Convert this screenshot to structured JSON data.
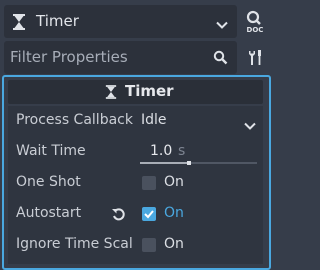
{
  "node_selector": {
    "name": "Timer",
    "icon": "hourglass-icon"
  },
  "doc_button": {
    "label": "DOC"
  },
  "filter": {
    "placeholder": "Filter Properties"
  },
  "section": {
    "title": "Timer"
  },
  "properties": {
    "process_callback": {
      "label": "Process Callback",
      "value": "Idle"
    },
    "wait_time": {
      "label": "Wait Time",
      "value": "1.0",
      "unit": "s",
      "slider_fraction": 0.42
    },
    "one_shot": {
      "label": "One Shot",
      "value": "On",
      "checked": false
    },
    "autostart": {
      "label": "Autostart",
      "value": "On",
      "checked": true
    },
    "ignore_time_scale": {
      "label": "Ignore Time Scal",
      "value": "On",
      "checked": false
    }
  },
  "colors": {
    "accent": "#4aa8e0",
    "background": "#363d4a",
    "field": "#2c313b"
  }
}
